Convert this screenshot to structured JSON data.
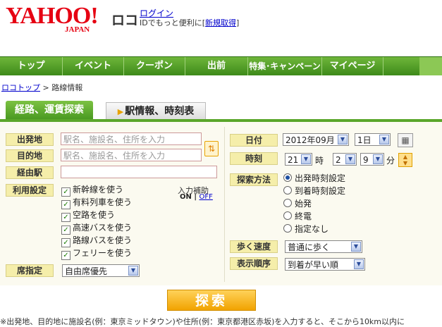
{
  "header": {
    "logo_text": "YAHOO!",
    "logo_sub": "JAPAN",
    "service_name": "ロコ",
    "login_link": "ログイン",
    "promo_prefix": "IDでもっと便利に[",
    "promo_link": "新規取得",
    "promo_suffix": "]"
  },
  "nav": {
    "items": [
      "トップ",
      "イベント",
      "クーポン",
      "出前",
      "特集･キャンペーン",
      "マイページ"
    ]
  },
  "breadcrumb": {
    "home": "ロコトップ",
    "separator": ">",
    "current": "路線情報"
  },
  "tabs": {
    "active": "経路、運賃探索",
    "inactive": "駅情報、時刻表"
  },
  "form": {
    "departure_label": "出発地",
    "departure_placeholder": "駅名、施設名、住所を入力",
    "arrival_label": "目的地",
    "arrival_placeholder": "駅名、施設名、住所を入力",
    "via_label": "経由駅",
    "via_value": "",
    "options_label": "利用設定",
    "options": [
      {
        "label": "新幹線を使う",
        "checked": true
      },
      {
        "label": "有料列車を使う",
        "checked": true
      },
      {
        "label": "空路を使う",
        "checked": true
      },
      {
        "label": "高速バスを使う",
        "checked": true
      },
      {
        "label": "路線バスを使う",
        "checked": true
      },
      {
        "label": "フェリーを使う",
        "checked": true
      }
    ],
    "assist_label": "入力補助",
    "assist_on": "ON",
    "assist_sep": "|",
    "assist_off": "OFF",
    "seat_label": "席指定",
    "seat_value": "自由席優先",
    "date_label": "日付",
    "date_month": "2012年09月",
    "date_day": "1日",
    "time_label": "時刻",
    "hour_value": "21",
    "hour_unit": "時",
    "minute_tens": "2",
    "minute_ones": "9",
    "minute_unit": "分",
    "method_label": "探索方法",
    "methods": [
      {
        "label": "出発時刻設定",
        "selected": true
      },
      {
        "label": "到着時刻設定",
        "selected": false
      },
      {
        "label": "始発",
        "selected": false
      },
      {
        "label": "終電",
        "selected": false
      },
      {
        "label": "指定なし",
        "selected": false
      }
    ],
    "walk_label": "歩く速度",
    "walk_value": "普通に歩く",
    "order_label": "表示順序",
    "order_value": "到着が早い順",
    "search_button": "探索"
  },
  "footnote": "※出発地、目的地に施設名(例：東京ミッドタウン)や住所(例：東京都港区赤坂)を入力すると、そこから10km以内に",
  "icons": {
    "swap": "swap-arrows-icon",
    "calendar": "calendar-icon",
    "spinner": "time-spinner-icon",
    "dropdown": "chevron-down-icon"
  },
  "colors": {
    "brand_red": "#e60012",
    "nav_green": "#4a9a22",
    "label_yellow": "#f5eeaa",
    "search_orange": "#f1a300"
  }
}
